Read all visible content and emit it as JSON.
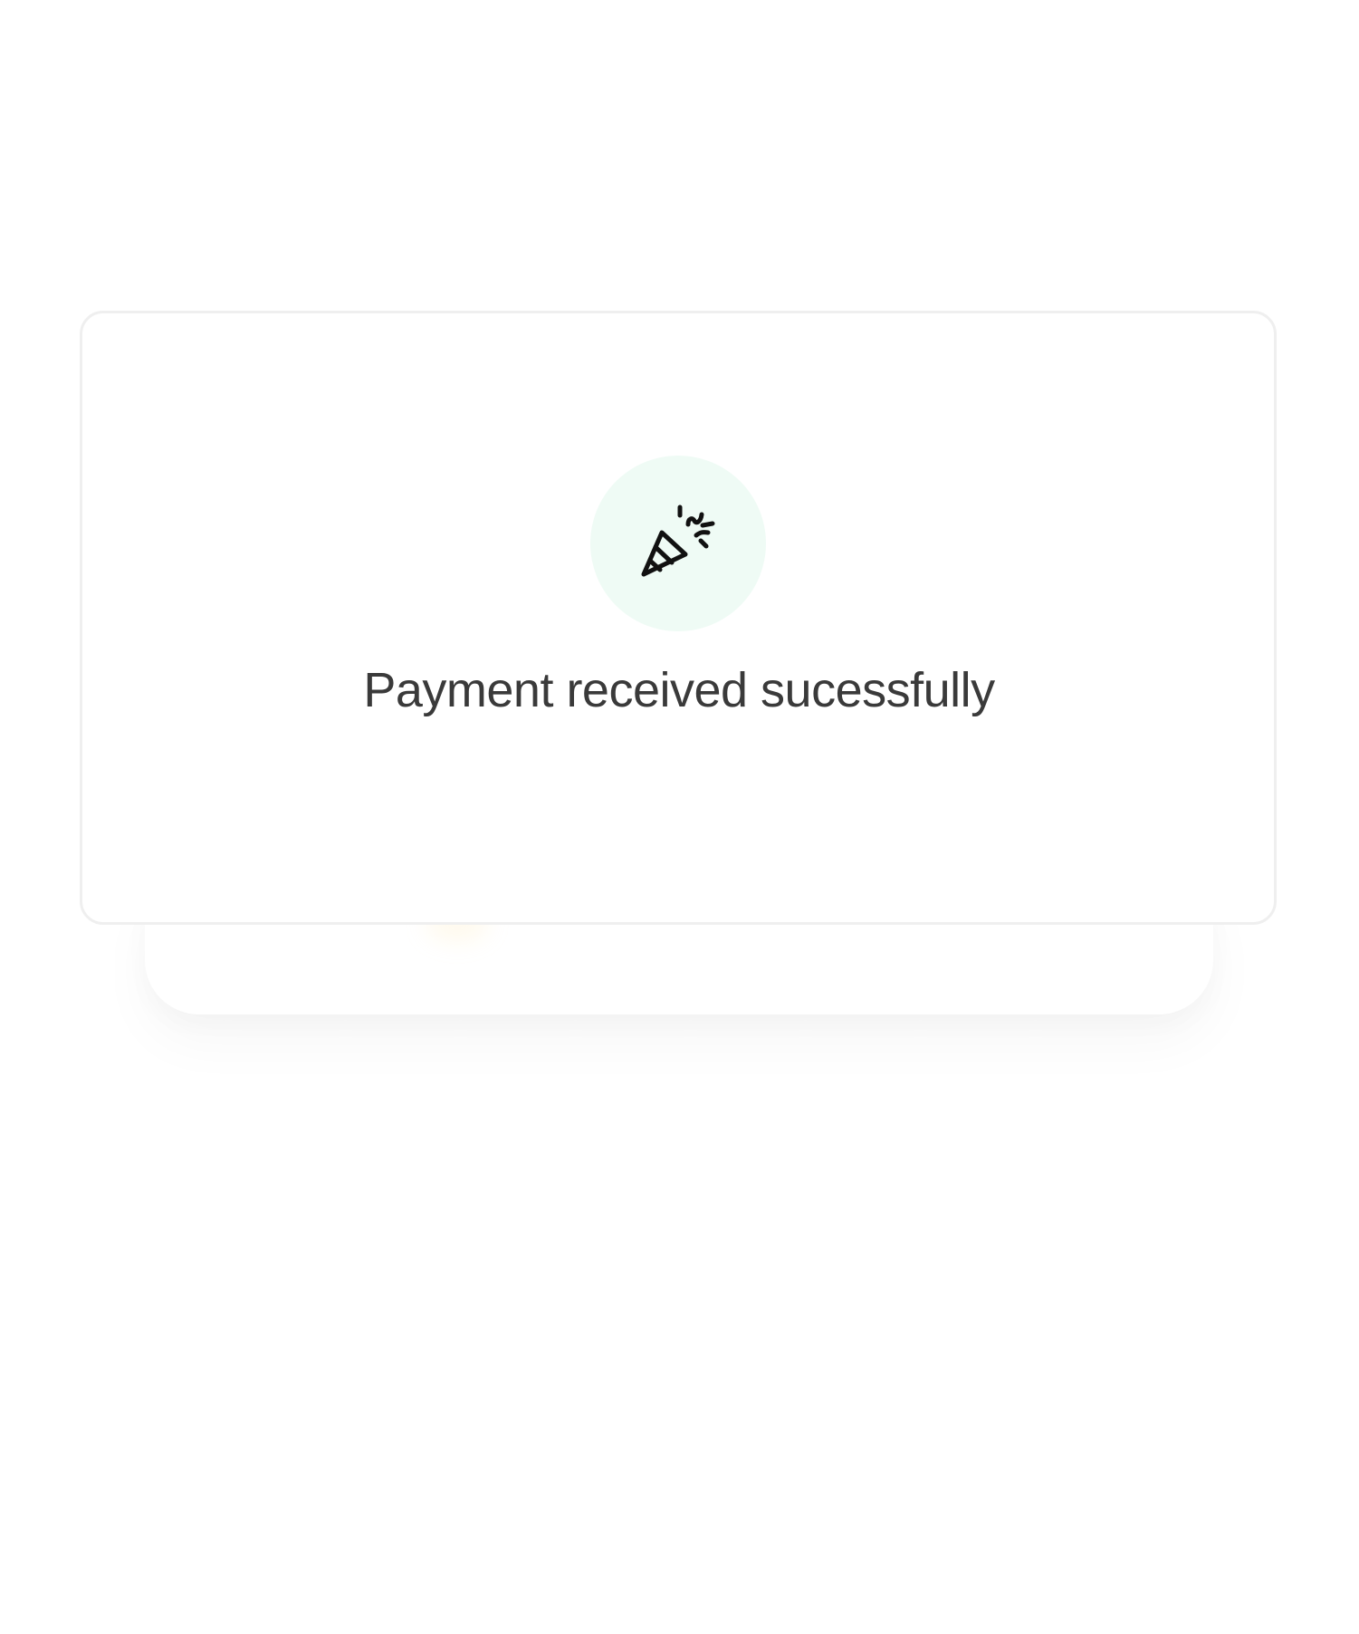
{
  "success_card": {
    "message": "Payment received sucessfully",
    "icon": "party-popper-icon",
    "icon_background_color": "#effbf5",
    "text_color": "#3a3a3a"
  }
}
